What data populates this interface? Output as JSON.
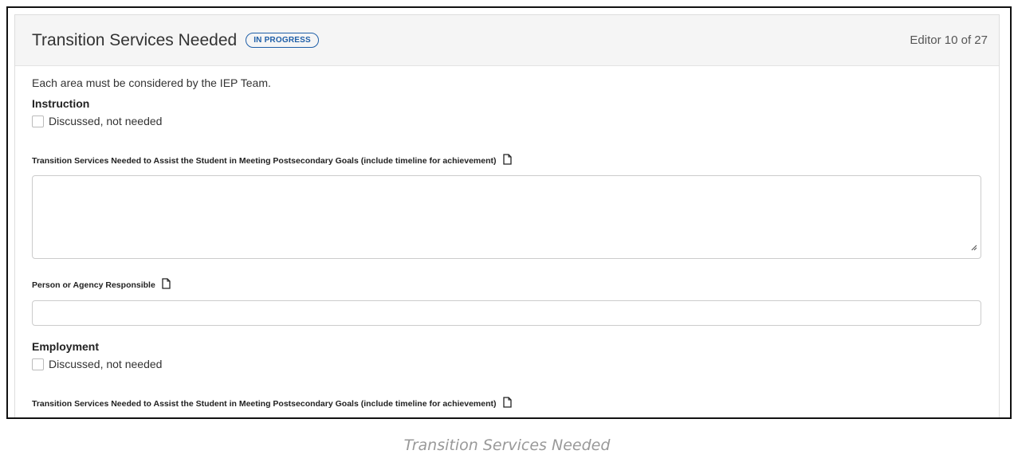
{
  "header": {
    "title": "Transition Services Needed",
    "status_badge": "IN PROGRESS",
    "editor_counter": "Editor 10 of 27",
    "badge_color": "#1f5fa8"
  },
  "intro_text": "Each area must be considered by the IEP Team.",
  "sections": [
    {
      "title": "Instruction",
      "checkbox_label": "Discussed, not needed",
      "services_label": "Transition Services Needed to Assist the Student in Meeting Postsecondary Goals (include timeline for achievement)",
      "services_value": "",
      "responsible_label": "Person or Agency Responsible",
      "responsible_value": ""
    },
    {
      "title": "Employment",
      "checkbox_label": "Discussed, not needed",
      "services_label": "Transition Services Needed to Assist the Student in Meeting Postsecondary Goals (include timeline for achievement)"
    }
  ],
  "caption": "Transition Services Needed",
  "icons": {
    "field_note": "document-icon",
    "textarea_resize": "resize-grip-icon"
  }
}
